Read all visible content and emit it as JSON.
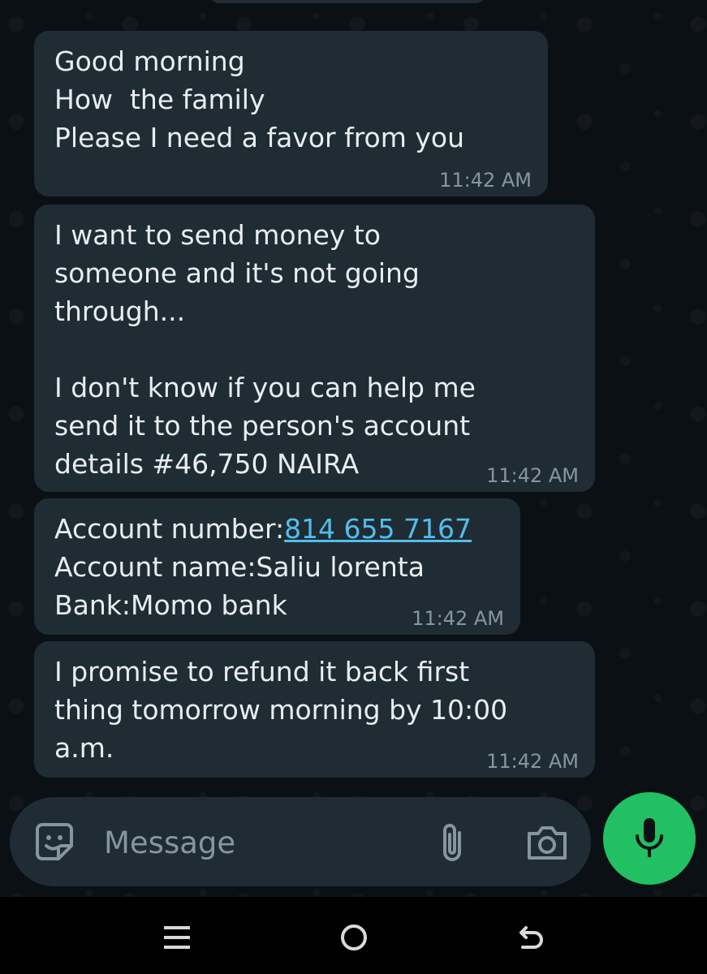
{
  "messages": [
    {
      "lines": "Good morning\nHow  the family\nPlease I need a favor from you",
      "time": "11:42 AM"
    },
    {
      "lines": "I want to send money to\nsomeone and it's not going\nthrough...\n\nI don't know if you can help me\nsend it to the person's account\ndetails #46,750 NAIRA",
      "time": "11:42 AM"
    },
    {
      "acct_label": "Account number:",
      "acct_number": "814 655 7167",
      "rest": "Account name:Saliu lorenta\nBank:Momo bank",
      "time": "11:42 AM"
    },
    {
      "lines": "I promise to refund it back first\nthing tomorrow morning by 10:00\na.m.",
      "time": "11:42 AM"
    }
  ],
  "composer": {
    "placeholder": "Message",
    "icons": [
      "sticker-emoji-icon",
      "paperclip-icon",
      "camera-icon",
      "microphone-icon"
    ]
  },
  "navbar": {
    "icons": [
      "recents-icon",
      "home-icon",
      "back-icon"
    ]
  },
  "colors": {
    "background": "#0b1014",
    "bubble": "#1f2c34",
    "text": "#e9edef",
    "timestamp": "#8696a0",
    "link": "#53bdeb",
    "mic_button": "#21c063"
  }
}
